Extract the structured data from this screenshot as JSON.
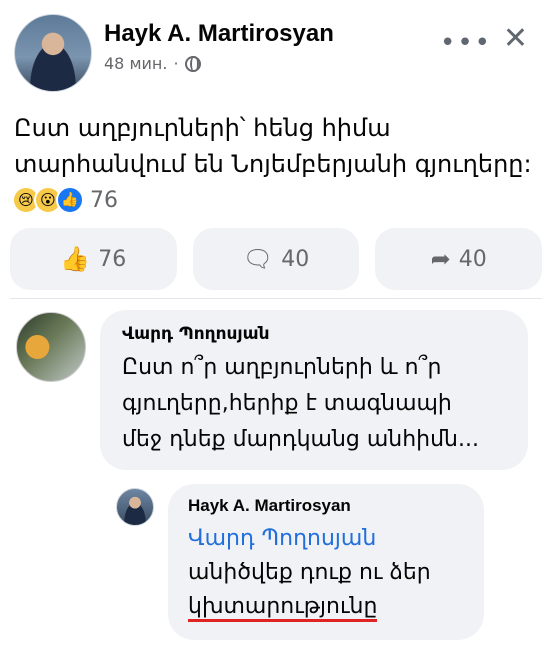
{
  "post": {
    "author": "Hayk A. Martirosyan",
    "time": "48 мин.",
    "time_sep": "·",
    "more_icon": "more-dots-icon",
    "close_icon": "close-icon",
    "text_line1": "Ըստ աղբյուրների՝ հենց հիմա",
    "text_line2": "տարհանվում են Նոյեմբերյանի գյուղերը:",
    "reaction_count": "76"
  },
  "actions": {
    "like_count": "76",
    "comment_count": "40",
    "share_count": "40"
  },
  "comments": [
    {
      "name": "Վարդ Պողոսյան",
      "text_line1": "Ըստ ո՞ր աղբյուրների և ո՞ր",
      "text_line2": "գյուղերը,հերիք է տագնապի",
      "text_line3": "մեջ դնեք մարդկանց անհիմն..."
    },
    {
      "name": "Hayk A. Martirosyan",
      "mention": "Վարդ Պողոսյան",
      "text_line2": "անիծվեք դուք ու ձեր",
      "text_line3": "կխտարությունը"
    }
  ],
  "colors": {
    "mention": "#216fdb",
    "underline": "#e02424",
    "bubble": "#f0f2f5"
  }
}
